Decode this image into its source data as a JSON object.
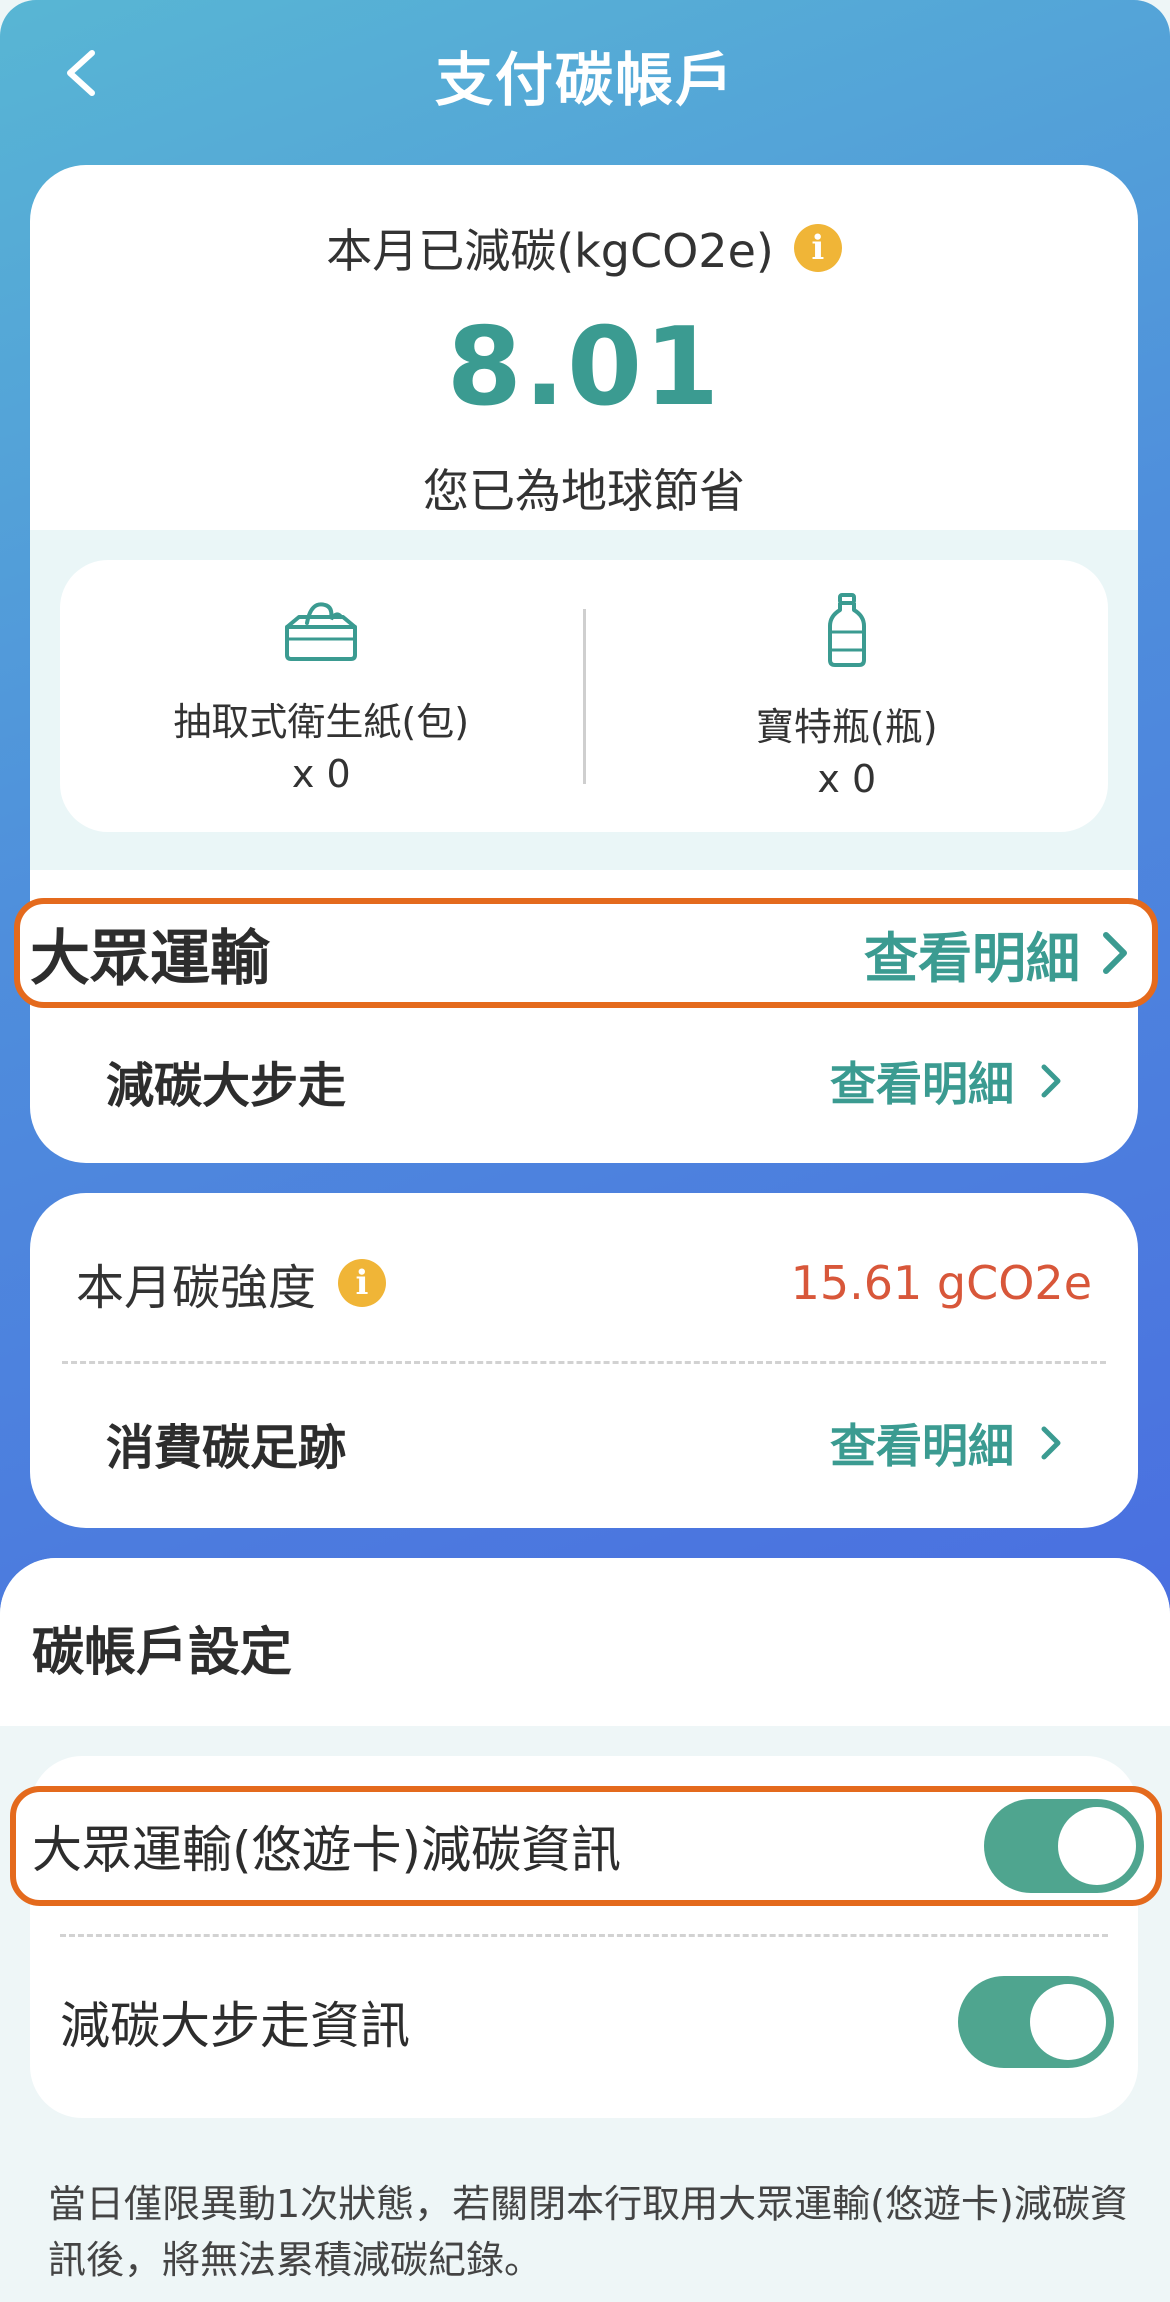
{
  "header": {
    "title": "支付碳帳戶"
  },
  "summary": {
    "label": "本月已減碳(kgCO2e)",
    "value": "8.01",
    "subtitle": "您已為地球節省"
  },
  "savings": [
    {
      "name": "抽取式衛生紙(包)",
      "count": "x 0",
      "icon": "tissue-box-icon"
    },
    {
      "name": "寶特瓶(瓶)",
      "count": "x 0",
      "icon": "bottle-icon"
    }
  ],
  "rows": {
    "transit": {
      "label": "大眾運輸",
      "link": "查看明細"
    },
    "walk": {
      "label": "減碳大步走",
      "link": "查看明細"
    }
  },
  "intensity": {
    "label": "本月碳強度",
    "value": "15.61 gCO2e",
    "footprint_label": "消費碳足跡",
    "footprint_link": "查看明細"
  },
  "settings": {
    "title": "碳帳戶設定",
    "toggles": [
      {
        "label": "大眾運輸(悠遊卡)減碳資訊",
        "on": true
      },
      {
        "label": "減碳大步走資訊",
        "on": true
      }
    ],
    "note": "當日僅限異動1次狀態，若關閉本行取用大眾運輸(悠遊卡)減碳資訊後，將無法累積減碳紀錄。"
  },
  "colors": {
    "accent": "#3b9b91",
    "highlight": "#e46a1d",
    "info": "#f0b537",
    "intensity": "#d8573a",
    "toggle_on": "#4fa58f"
  }
}
